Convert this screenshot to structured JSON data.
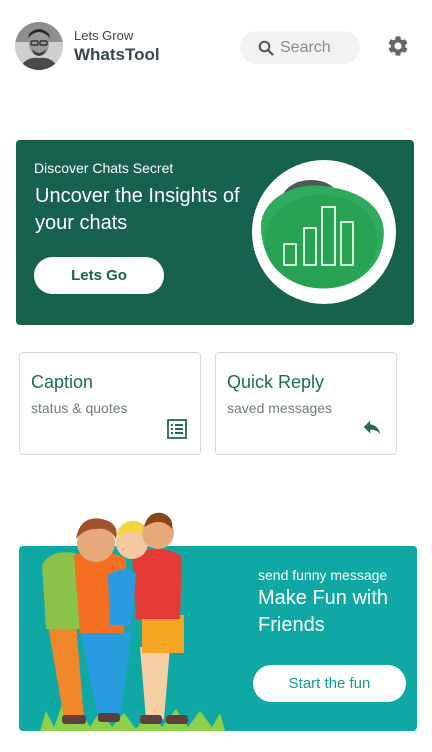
{
  "header": {
    "greeting": "Lets Grow",
    "app_name": "WhatsTool",
    "avatar_icon": "user-avatar-photo",
    "settings_icon": "gear-icon"
  },
  "search": {
    "placeholder": "Search",
    "icon": "search-icon"
  },
  "hero": {
    "kicker": "Discover Chats Secret",
    "title": "Uncover the Insights of your chats",
    "button_label": "Lets Go",
    "background_color": "#17614f",
    "illustration": "bar-chart-icon"
  },
  "cards": [
    {
      "title": "Caption",
      "subtitle": "status & quotes",
      "icon": "list-icon"
    },
    {
      "title": "Quick Reply",
      "subtitle": "saved messages",
      "icon": "reply-icon"
    }
  ],
  "fun": {
    "kicker": "send funny message",
    "title": "Make Fun with Friends",
    "button_label": "Start the fun",
    "background_color": "#10a8a5",
    "illustration": "laughing-friends-illustration"
  },
  "colors": {
    "primary": "#17614f",
    "accent": "#2fab5f",
    "teal": "#10a8a5"
  }
}
